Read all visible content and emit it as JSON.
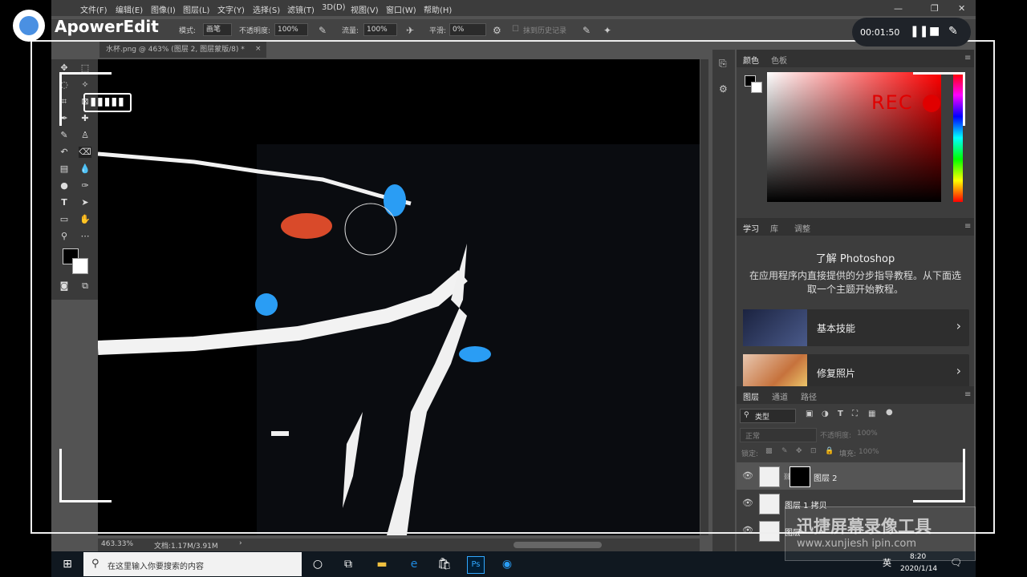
{
  "recorder": {
    "app_name": "ApowerEdit",
    "timer": "00:01:50",
    "rec_label": "REC",
    "watermark_title": "迅捷屏幕录像工具",
    "watermark_url": "www.xunjiesh ipin.com"
  },
  "menu": {
    "items": [
      "文件(F)",
      "编辑(E)",
      "图像(I)",
      "图层(L)",
      "文字(Y)",
      "选择(S)",
      "滤镜(T)",
      "3D(D)",
      "视图(V)",
      "窗口(W)",
      "帮助(H)"
    ]
  },
  "options": {
    "mode_label": "模式:",
    "mode_value": "画笔",
    "opacity_label": "不透明度:",
    "opacity_value": "100%",
    "flow_label": "流量:",
    "flow_value": "100%",
    "smooth_label": "平滑:",
    "smooth_value": "0%",
    "history_label": "抹到历史记录"
  },
  "document": {
    "tab_title": "水杯.png @ 463% (图层 2, 图层蒙版/8) *",
    "zoom": "463.33%",
    "doc_info": "文档:1.17M/3.91M"
  },
  "color_panel": {
    "tabs": [
      "颜色",
      "色板"
    ]
  },
  "learn_panel": {
    "tabs": [
      "学习",
      "库",
      "调整"
    ],
    "title": "了解 Photoshop",
    "description": "在应用程序内直接提供的分步指导教程。从下面选取一个主题开始教程。",
    "cards": [
      {
        "label": "基本技能"
      },
      {
        "label": "修复照片"
      }
    ]
  },
  "layers_panel": {
    "tabs": [
      "图层",
      "通道",
      "路径"
    ],
    "filter_label": "类型",
    "blend_mode": "正常",
    "opacity_label": "不透明度:",
    "opacity_value": "100%",
    "lock_label": "锁定:",
    "fill_label": "填充:",
    "fill_value": "100%",
    "layers": [
      {
        "name": "图层 2"
      },
      {
        "name": "图层 1 拷贝"
      },
      {
        "name": "图层"
      }
    ]
  },
  "taskbar": {
    "search_placeholder": "在这里输入你要搜索的内容",
    "ime": "英",
    "time": "8:20",
    "date": "2020/1/14"
  },
  "colors": {
    "ps_bg": "#535353",
    "panel_bg": "#3d3d3d",
    "rec_red": "#e00000",
    "butterfly_blue": "#2a9df4"
  }
}
